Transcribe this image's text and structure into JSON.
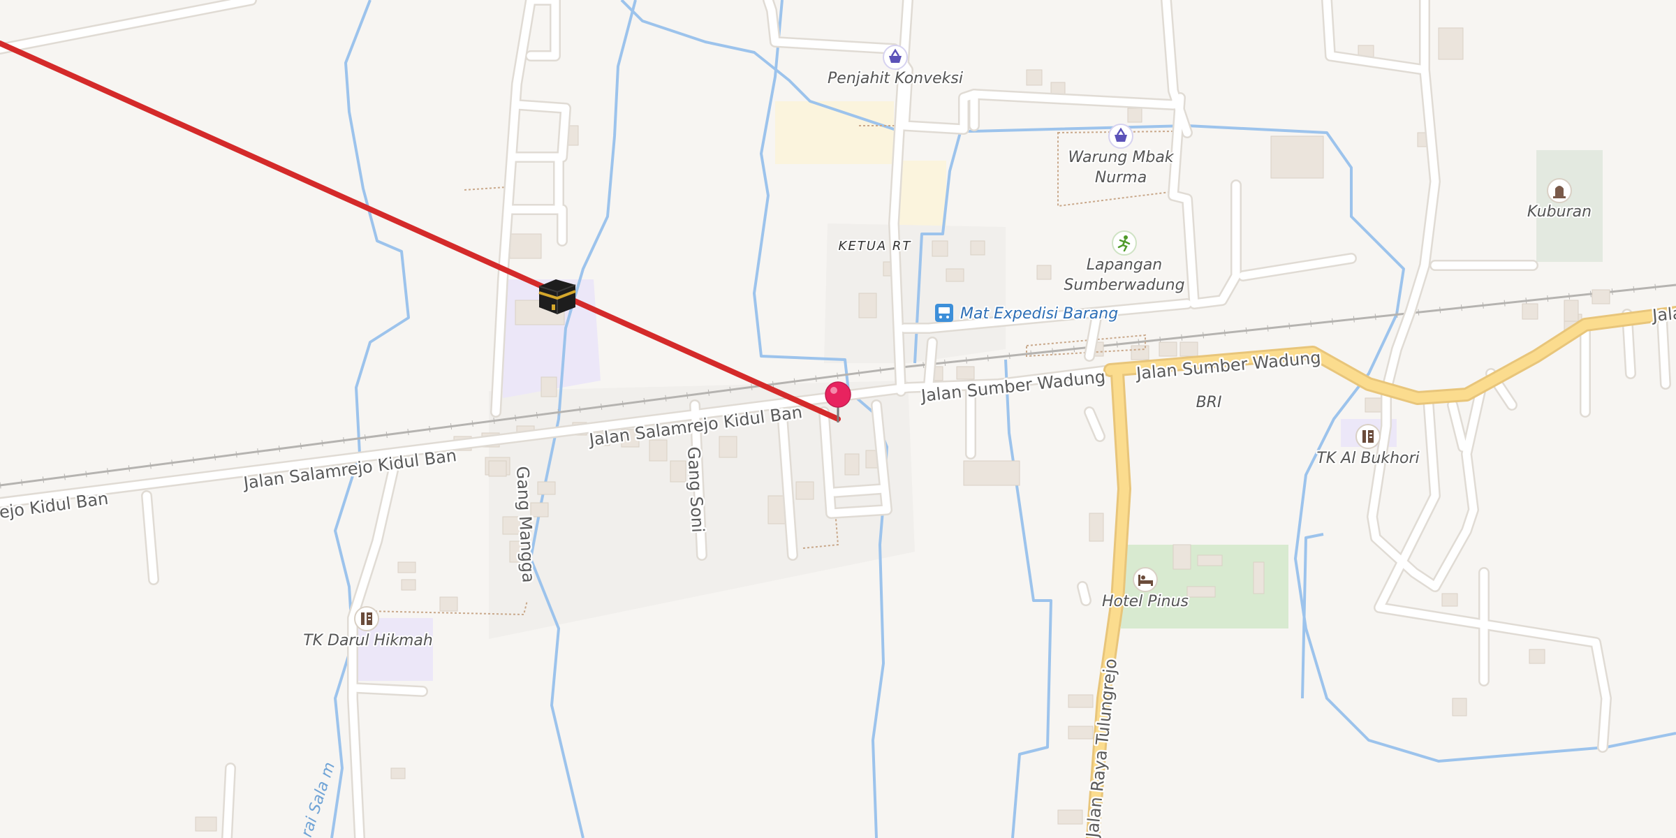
{
  "map": {
    "streets": {
      "salamrejo_1": "Jalan Salamrejo Kidul Ban",
      "salamrejo_2": "Jalan Salamrejo Kidul Ban",
      "salamrejo_3": "ejo Kidul Ban",
      "sumber_1": "Jalan Sumber Wadung",
      "sumber_2": "Jalan Sumber Wadung",
      "raya": "Jalan Raya Tulungrejo",
      "gang_mangga": "Gang Mangga",
      "gang_soni": "Gang Soni",
      "edge_right": "Jala"
    },
    "places": {
      "penjahit": "Penjahit Konveksi",
      "warung_1": "Warung Mbak",
      "warung_2": "Nurma",
      "kuburan": "Kuburan",
      "ketua_rt": "KETUA RT",
      "lapangan_1": "Lapangan",
      "lapangan_2": "Sumberwadung",
      "expedisi": "Mat Expedisi Barang",
      "bri": "BRI",
      "tk_bukhori": "TK Al Bukhori",
      "tk_darul": "TK Darul Hikmah",
      "hotel": "Hotel Pinus"
    },
    "water": {
      "stream_label": "rai Sala m"
    },
    "icons": {
      "penjahit": "shopping-basket-icon",
      "warung": "shopping-basket-icon",
      "kuburan": "cemetery-icon",
      "lapangan": "sports-field-icon",
      "expedisi": "bus-icon",
      "tk": "school-icon",
      "hotel": "bed-icon",
      "kaaba": "kaaba-icon",
      "pin": "location-pin"
    },
    "colors": {
      "background": "#f7f5f2",
      "road": "#ffffff",
      "major_road": "#fbdc8e",
      "water": "#9cc3ec",
      "route_line": "#d42a2a",
      "pin": "#e8235f",
      "park": "#d8ead0",
      "school_area": "#ece7f8"
    }
  }
}
